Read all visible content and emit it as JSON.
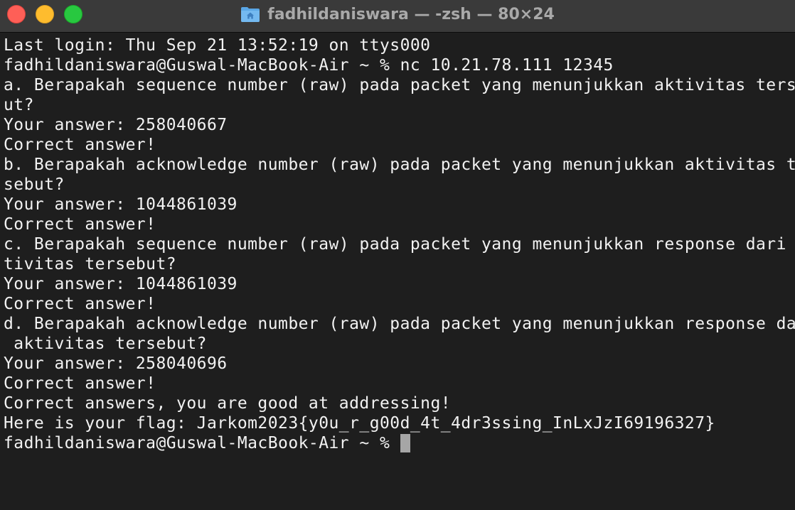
{
  "window": {
    "title": "fadhildaniswara — -zsh — 80×24",
    "title_icon": "home-folder-icon"
  },
  "terminal": {
    "lines": [
      "Last login: Thu Sep 21 13:52:19 on ttys000",
      "fadhildaniswara@Guswal-MacBook-Air ~ % nc 10.21.78.111 12345",
      "a. Berapakah sequence number (raw) pada packet yang menunjukkan aktivitas terseb",
      "ut?",
      "Your answer: 258040667",
      "Correct answer!",
      "b. Berapakah acknowledge number (raw) pada packet yang menunjukkan aktivitas ter",
      "sebut?",
      "Your answer: 1044861039",
      "Correct answer!",
      "c. Berapakah sequence number (raw) pada packet yang menunjukkan response dari ak",
      "tivitas tersebut?",
      "Your answer: 1044861039",
      "Correct answer!",
      "d. Berapakah acknowledge number (raw) pada packet yang menunjukkan response dari",
      " aktivitas tersebut?",
      "Your answer: 258040696",
      "Correct answer!",
      "Correct answers, you are good at addressing!",
      "Here is your flag: Jarkom2023{y0u_r_g00d_4t_4dr3ssing_InLxJzI69196327}"
    ],
    "prompt": "fadhildaniswara@Guswal-MacBook-Air ~ % "
  },
  "colors": {
    "background": "#1e1e1e",
    "titlebar": "#3a3a3a",
    "text": "#f2f2f2",
    "cursor": "#a6a6a6",
    "close": "#fe5f57",
    "minimize": "#febc2e",
    "zoom": "#28c840"
  }
}
